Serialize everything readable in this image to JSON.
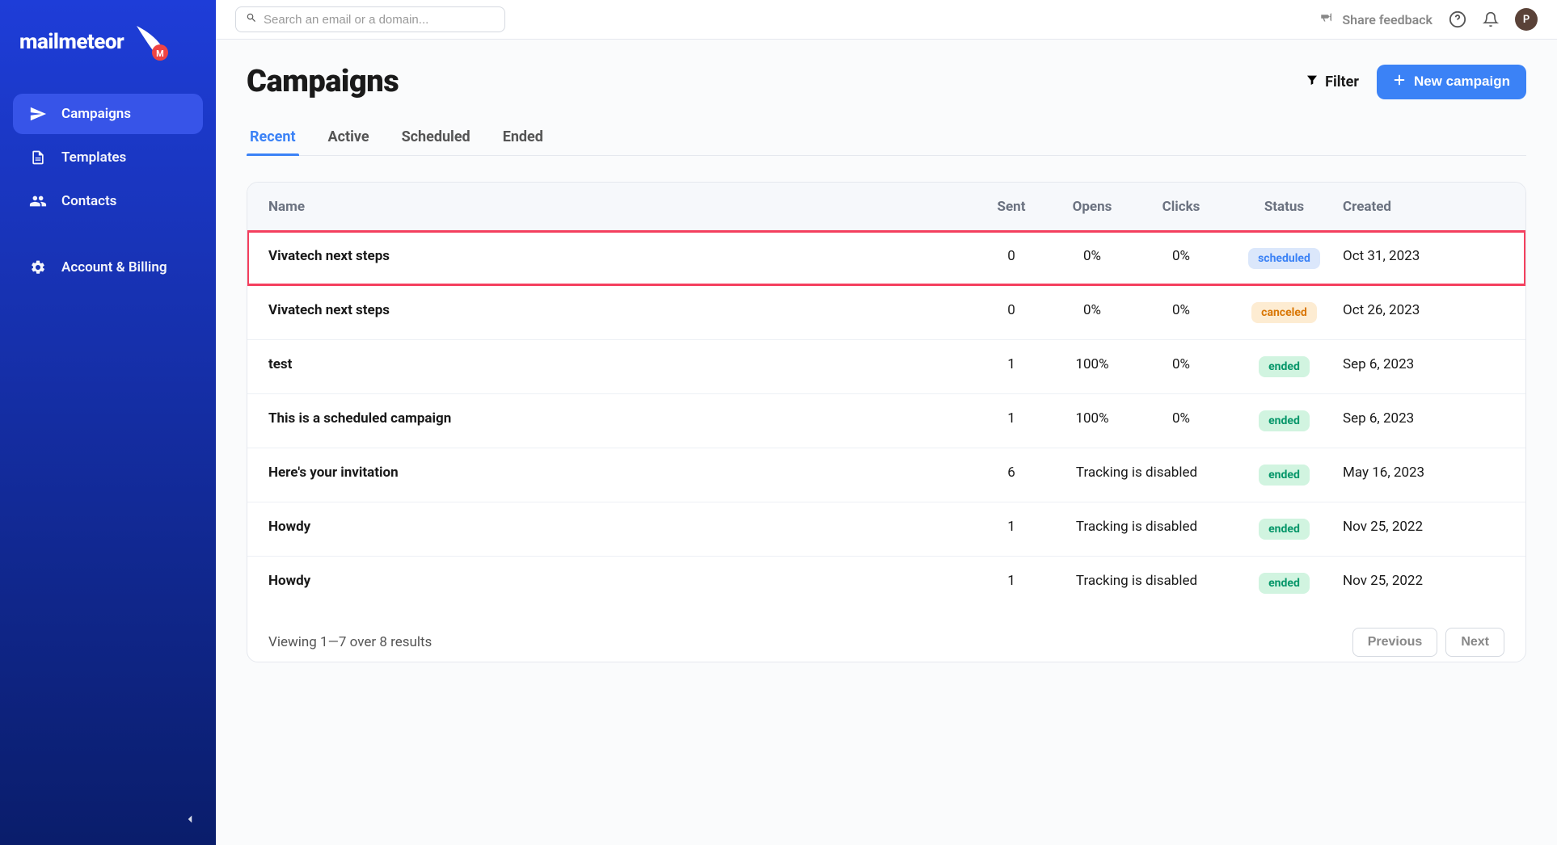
{
  "brand": {
    "name": "mailmeteor"
  },
  "sidebar": {
    "items": [
      {
        "label": "Campaigns",
        "icon": "send",
        "active": true
      },
      {
        "label": "Templates",
        "icon": "file",
        "active": false
      },
      {
        "label": "Contacts",
        "icon": "people",
        "active": false
      },
      {
        "label": "Account & Billing",
        "icon": "gear",
        "active": false
      }
    ]
  },
  "topbar": {
    "search_placeholder": "Search an email or a domain...",
    "feedback_label": "Share feedback",
    "avatar_initial": "P"
  },
  "page": {
    "title": "Campaigns",
    "filter_label": "Filter",
    "new_campaign_label": "New campaign"
  },
  "tabs": [
    {
      "label": "Recent",
      "active": true
    },
    {
      "label": "Active",
      "active": false
    },
    {
      "label": "Scheduled",
      "active": false
    },
    {
      "label": "Ended",
      "active": false
    }
  ],
  "table": {
    "columns": {
      "name": "Name",
      "sent": "Sent",
      "opens": "Opens",
      "clicks": "Clicks",
      "status": "Status",
      "created": "Created"
    },
    "rows": [
      {
        "name": "Vivatech next steps",
        "sent": "0",
        "opens": "0%",
        "clicks": "0%",
        "status": "scheduled",
        "created": "Oct 31, 2023",
        "tracking_disabled": false,
        "highlighted": true
      },
      {
        "name": "Vivatech next steps",
        "sent": "0",
        "opens": "0%",
        "clicks": "0%",
        "status": "canceled",
        "created": "Oct 26, 2023",
        "tracking_disabled": false,
        "highlighted": false
      },
      {
        "name": "test",
        "sent": "1",
        "opens": "100%",
        "clicks": "0%",
        "status": "ended",
        "created": "Sep 6, 2023",
        "tracking_disabled": false,
        "highlighted": false
      },
      {
        "name": "This is a scheduled campaign",
        "sent": "1",
        "opens": "100%",
        "clicks": "0%",
        "status": "ended",
        "created": "Sep 6, 2023",
        "tracking_disabled": false,
        "highlighted": false
      },
      {
        "name": "Here's your invitation",
        "sent": "6",
        "opens": "",
        "clicks": "",
        "status": "ended",
        "created": "May 16, 2023",
        "tracking_disabled": true,
        "tracking_text": "Tracking is disabled",
        "highlighted": false
      },
      {
        "name": "Howdy",
        "sent": "1",
        "opens": "",
        "clicks": "",
        "status": "ended",
        "created": "Nov 25, 2022",
        "tracking_disabled": true,
        "tracking_text": "Tracking is disabled",
        "highlighted": false
      },
      {
        "name": "Howdy",
        "sent": "1",
        "opens": "",
        "clicks": "",
        "status": "ended",
        "created": "Nov 25, 2022",
        "tracking_disabled": true,
        "tracking_text": "Tracking is disabled",
        "highlighted": false
      }
    ],
    "footer": {
      "results_text": "Viewing 1—7 over 8 results",
      "prev_label": "Previous",
      "next_label": "Next"
    }
  }
}
